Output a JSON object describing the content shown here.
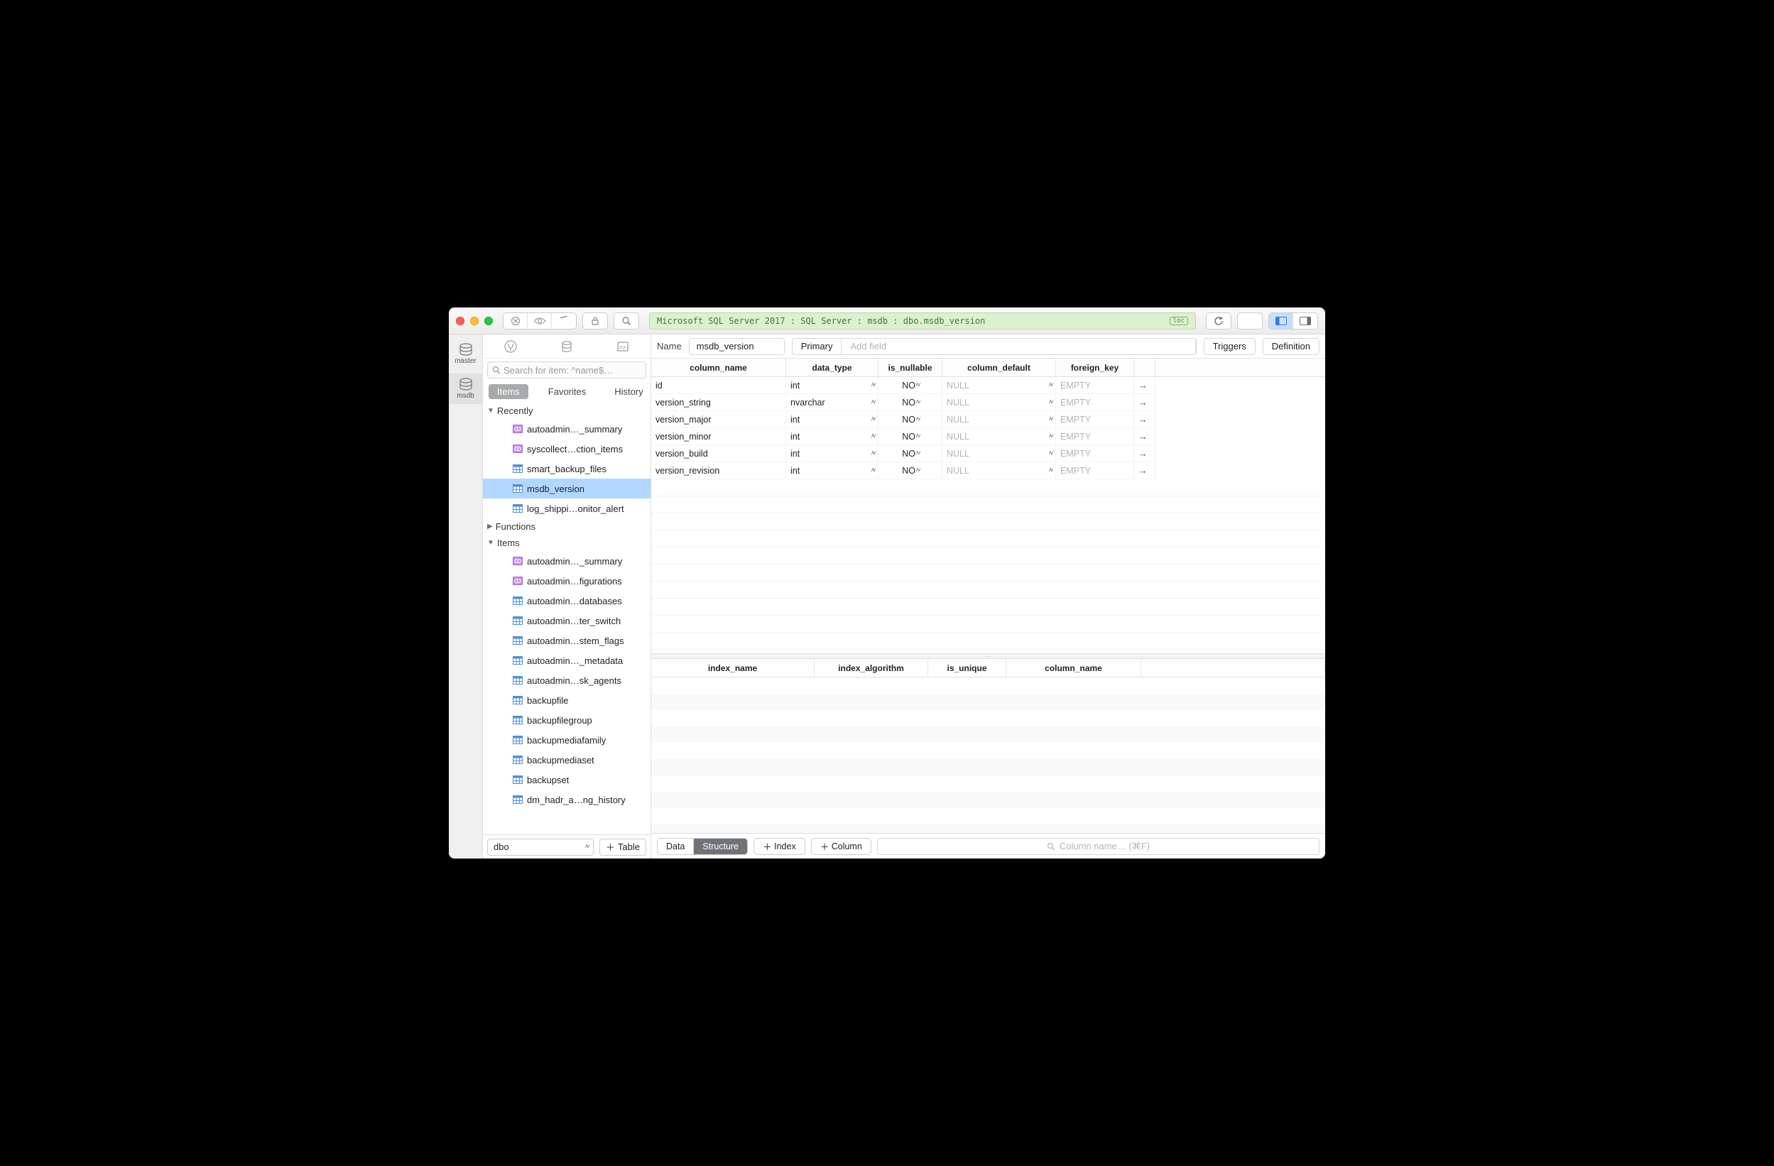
{
  "breadcrumb": "Microsoft SQL Server 2017 : SQL Server : msdb : dbo.msdb_version",
  "loc_badge": "loc",
  "db_strip": [
    {
      "label": "master",
      "selected": false
    },
    {
      "label": "msdb",
      "selected": true
    }
  ],
  "sidebar": {
    "search_placeholder": "Search for item: ^name$…",
    "tabs": [
      {
        "label": "Items",
        "active": true
      },
      {
        "label": "Favorites",
        "active": false
      },
      {
        "label": "History",
        "active": false
      }
    ],
    "sections": [
      {
        "title": "Recently",
        "expanded": true,
        "items": [
          {
            "icon": "view",
            "label": "autoadmin…_summary",
            "selected": false
          },
          {
            "icon": "view",
            "label": "syscollect…ction_items",
            "selected": false
          },
          {
            "icon": "table",
            "label": "smart_backup_files",
            "selected": false
          },
          {
            "icon": "table",
            "label": "msdb_version",
            "selected": true
          },
          {
            "icon": "table",
            "label": "log_shippi…onitor_alert",
            "selected": false
          }
        ]
      },
      {
        "title": "Functions",
        "expanded": false,
        "items": []
      },
      {
        "title": "Items",
        "expanded": true,
        "items": [
          {
            "icon": "view",
            "label": "autoadmin…_summary"
          },
          {
            "icon": "view",
            "label": "autoadmin…figurations"
          },
          {
            "icon": "table",
            "label": "autoadmin…databases"
          },
          {
            "icon": "table",
            "label": "autoadmin…ter_switch"
          },
          {
            "icon": "table",
            "label": "autoadmin…stem_flags"
          },
          {
            "icon": "table",
            "label": "autoadmin…_metadata"
          },
          {
            "icon": "table",
            "label": "autoadmin…sk_agents"
          },
          {
            "icon": "table",
            "label": "backupfile"
          },
          {
            "icon": "table",
            "label": "backupfilegroup"
          },
          {
            "icon": "table",
            "label": "backupmediafamily"
          },
          {
            "icon": "table",
            "label": "backupmediaset"
          },
          {
            "icon": "table",
            "label": "backupset"
          },
          {
            "icon": "table",
            "label": "dm_hadr_a…ng_history"
          }
        ]
      }
    ],
    "schema_selector": "dbo",
    "add_table_label": "Table"
  },
  "main": {
    "name_label": "Name",
    "name_value": "msdb_version",
    "primary_label": "Primary",
    "add_field_placeholder": "Add field",
    "triggers_label": "Triggers",
    "definition_label": "Definition",
    "column_headers": [
      "column_name",
      "data_type",
      "is_nullable",
      "column_default",
      "foreign_key"
    ],
    "rows": [
      {
        "name": "id",
        "type": "int",
        "nullable": "NO",
        "default": "NULL",
        "fk": "EMPTY"
      },
      {
        "name": "version_string",
        "type": "nvarchar",
        "nullable": "NO",
        "default": "NULL",
        "fk": "EMPTY"
      },
      {
        "name": "version_major",
        "type": "int",
        "nullable": "NO",
        "default": "NULL",
        "fk": "EMPTY"
      },
      {
        "name": "version_minor",
        "type": "int",
        "nullable": "NO",
        "default": "NULL",
        "fk": "EMPTY"
      },
      {
        "name": "version_build",
        "type": "int",
        "nullable": "NO",
        "default": "NULL",
        "fk": "EMPTY"
      },
      {
        "name": "version_revision",
        "type": "int",
        "nullable": "NO",
        "default": "NULL",
        "fk": "EMPTY"
      }
    ],
    "index_headers": [
      "index_name",
      "index_algorithm",
      "is_unique",
      "column_name"
    ]
  },
  "footer": {
    "data_label": "Data",
    "structure_label": "Structure",
    "index_label": "Index",
    "column_label": "Column",
    "search_placeholder": "Column name… (⌘F)"
  }
}
